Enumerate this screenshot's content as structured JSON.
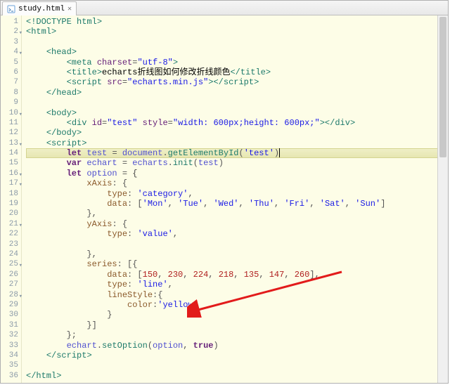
{
  "tab": {
    "filename": "study.html"
  },
  "gutter": [
    {
      "n": "1",
      "fold": false
    },
    {
      "n": "2",
      "fold": true
    },
    {
      "n": "3",
      "fold": false
    },
    {
      "n": "4",
      "fold": true
    },
    {
      "n": "5",
      "fold": false
    },
    {
      "n": "6",
      "fold": false
    },
    {
      "n": "7",
      "fold": false
    },
    {
      "n": "8",
      "fold": false
    },
    {
      "n": "9",
      "fold": false
    },
    {
      "n": "10",
      "fold": true
    },
    {
      "n": "11",
      "fold": false
    },
    {
      "n": "12",
      "fold": false
    },
    {
      "n": "13",
      "fold": true
    },
    {
      "n": "14",
      "fold": false
    },
    {
      "n": "15",
      "fold": false
    },
    {
      "n": "16",
      "fold": true
    },
    {
      "n": "17",
      "fold": true
    },
    {
      "n": "18",
      "fold": false
    },
    {
      "n": "19",
      "fold": false
    },
    {
      "n": "20",
      "fold": false
    },
    {
      "n": "21",
      "fold": true
    },
    {
      "n": "22",
      "fold": false
    },
    {
      "n": "23",
      "fold": false
    },
    {
      "n": "24",
      "fold": false
    },
    {
      "n": "25",
      "fold": true
    },
    {
      "n": "26",
      "fold": false
    },
    {
      "n": "27",
      "fold": false
    },
    {
      "n": "28",
      "fold": true
    },
    {
      "n": "29",
      "fold": false
    },
    {
      "n": "30",
      "fold": false
    },
    {
      "n": "31",
      "fold": false
    },
    {
      "n": "32",
      "fold": false
    },
    {
      "n": "33",
      "fold": false
    },
    {
      "n": "34",
      "fold": false
    },
    {
      "n": "35",
      "fold": false
    },
    {
      "n": "36",
      "fold": false
    }
  ],
  "code": {
    "doctype": "<!DOCTYPE html>",
    "html_open": "html",
    "head_open": "head",
    "meta_attr": "charset",
    "meta_val": "\"utf-8\"",
    "title_open": "title",
    "title_text": "echarts折线图如何修改折线颜色",
    "script_attr": "src",
    "script_src": "\"echarts.min.js\"",
    "script_tag": "script",
    "head_close": "head",
    "body_open": "body",
    "div_tag": "div",
    "div_id_attr": "id",
    "div_id_val": "\"test\"",
    "div_style_attr": "style",
    "div_style_val": "\"width: 600px;height: 600px;\"",
    "body_close": "body",
    "let": "let",
    "var": "var",
    "test_var": "test",
    "doc": "document",
    "gEBI": "getElementById",
    "gEBI_arg": "'test'",
    "echart_var": "echart",
    "echarts_ns": "echarts",
    "init_fn": "init",
    "init_arg": "test",
    "option_var": "option",
    "xAxis": "xAxis",
    "type_prop": "type",
    "category": "'category'",
    "data_prop": "data",
    "days": [
      "'Mon'",
      "'Tue'",
      "'Wed'",
      "'Thu'",
      "'Fri'",
      "'Sat'",
      "'Sun'"
    ],
    "yAxis": "yAxis",
    "value": "'value'",
    "series": "series",
    "series_data": [
      "150",
      "230",
      "224",
      "218",
      "135",
      "147",
      "260"
    ],
    "line": "'line'",
    "lineStyle": "lineStyle",
    "color_prop": "color",
    "yellow": "'yellow'",
    "setOption": "setOption",
    "true": "true",
    "html_close": "html"
  },
  "chart_data": {
    "type": "line",
    "categories": [
      "Mon",
      "Tue",
      "Wed",
      "Thu",
      "Fri",
      "Sat",
      "Sun"
    ],
    "values": [
      150,
      230,
      224,
      218,
      135,
      147,
      260
    ],
    "xlabel": "",
    "ylabel": "",
    "title": "echarts折线图如何修改折线颜色",
    "line_color": "yellow",
    "x_axis_type": "category",
    "y_axis_type": "value"
  }
}
